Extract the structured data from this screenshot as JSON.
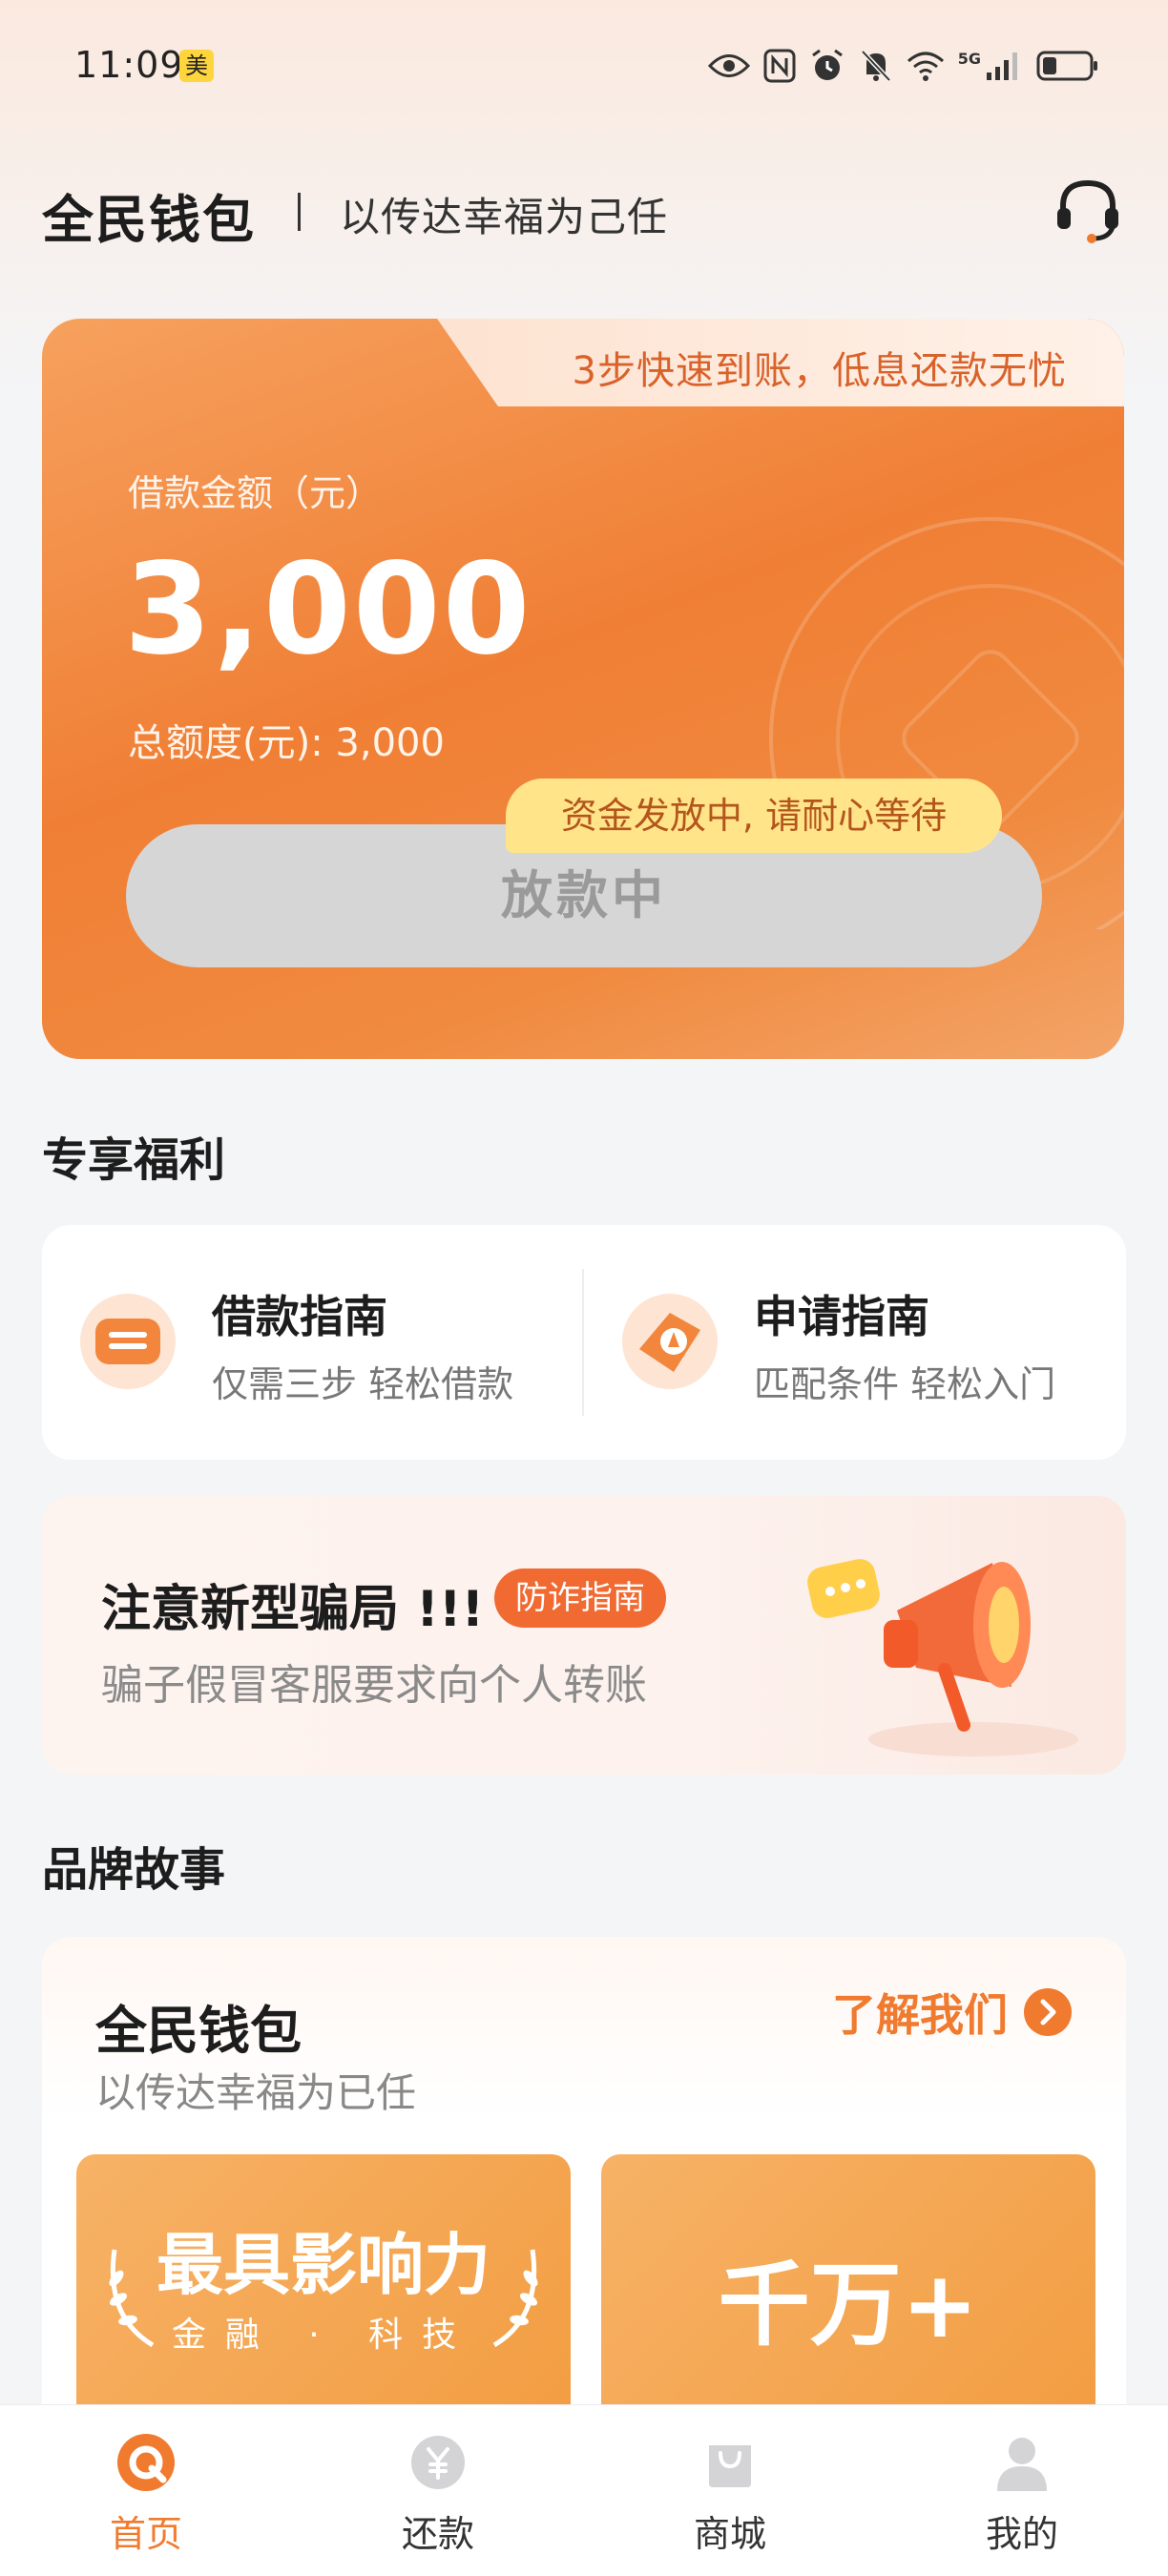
{
  "status_bar": {
    "time": "11:09",
    "app_badge": "美",
    "network": "5G"
  },
  "header": {
    "app_name": "全民钱包",
    "slogan": "以传达幸福为己任"
  },
  "loan_card": {
    "tab_text": "3步快速到账，低息还款无忧",
    "amount_label": "借款金额（元）",
    "amount_value": "3,000",
    "total_limit": "总额度(元): 3,000",
    "button_label": "放款中",
    "tip": "资金发放中, 请耐心等待"
  },
  "benefits": {
    "title": "专享福利",
    "items": [
      {
        "title": "借款指南",
        "subtitle": "仅需三步 轻松借款"
      },
      {
        "title": "申请指南",
        "subtitle": "匹配条件 轻松入门"
      }
    ]
  },
  "fraud_notice": {
    "title": "注意新型骗局 !!!",
    "tag": "防诈指南",
    "description": "骗子假冒客服要求向个人转账"
  },
  "brand_story": {
    "section_title": "品牌故事",
    "title": "全民钱包",
    "subtitle": "以传达幸福为已任",
    "link": "了解我们",
    "tiles": [
      {
        "main": "最具影响力",
        "sub": "金融 · 科技"
      },
      {
        "main": "千万+"
      }
    ]
  },
  "bottom_nav": {
    "items": [
      {
        "label": "首页",
        "icon": "home-icon",
        "active": true
      },
      {
        "label": "还款",
        "icon": "repay-icon",
        "active": false
      },
      {
        "label": "商城",
        "icon": "shop-icon",
        "active": false
      },
      {
        "label": "我的",
        "icon": "profile-icon",
        "active": false
      }
    ]
  },
  "colors": {
    "accent": "#f07a2e",
    "card_orange": "#f07f35",
    "tip_yellow": "#ffe48a",
    "fraud_tag": "#f06a32"
  }
}
